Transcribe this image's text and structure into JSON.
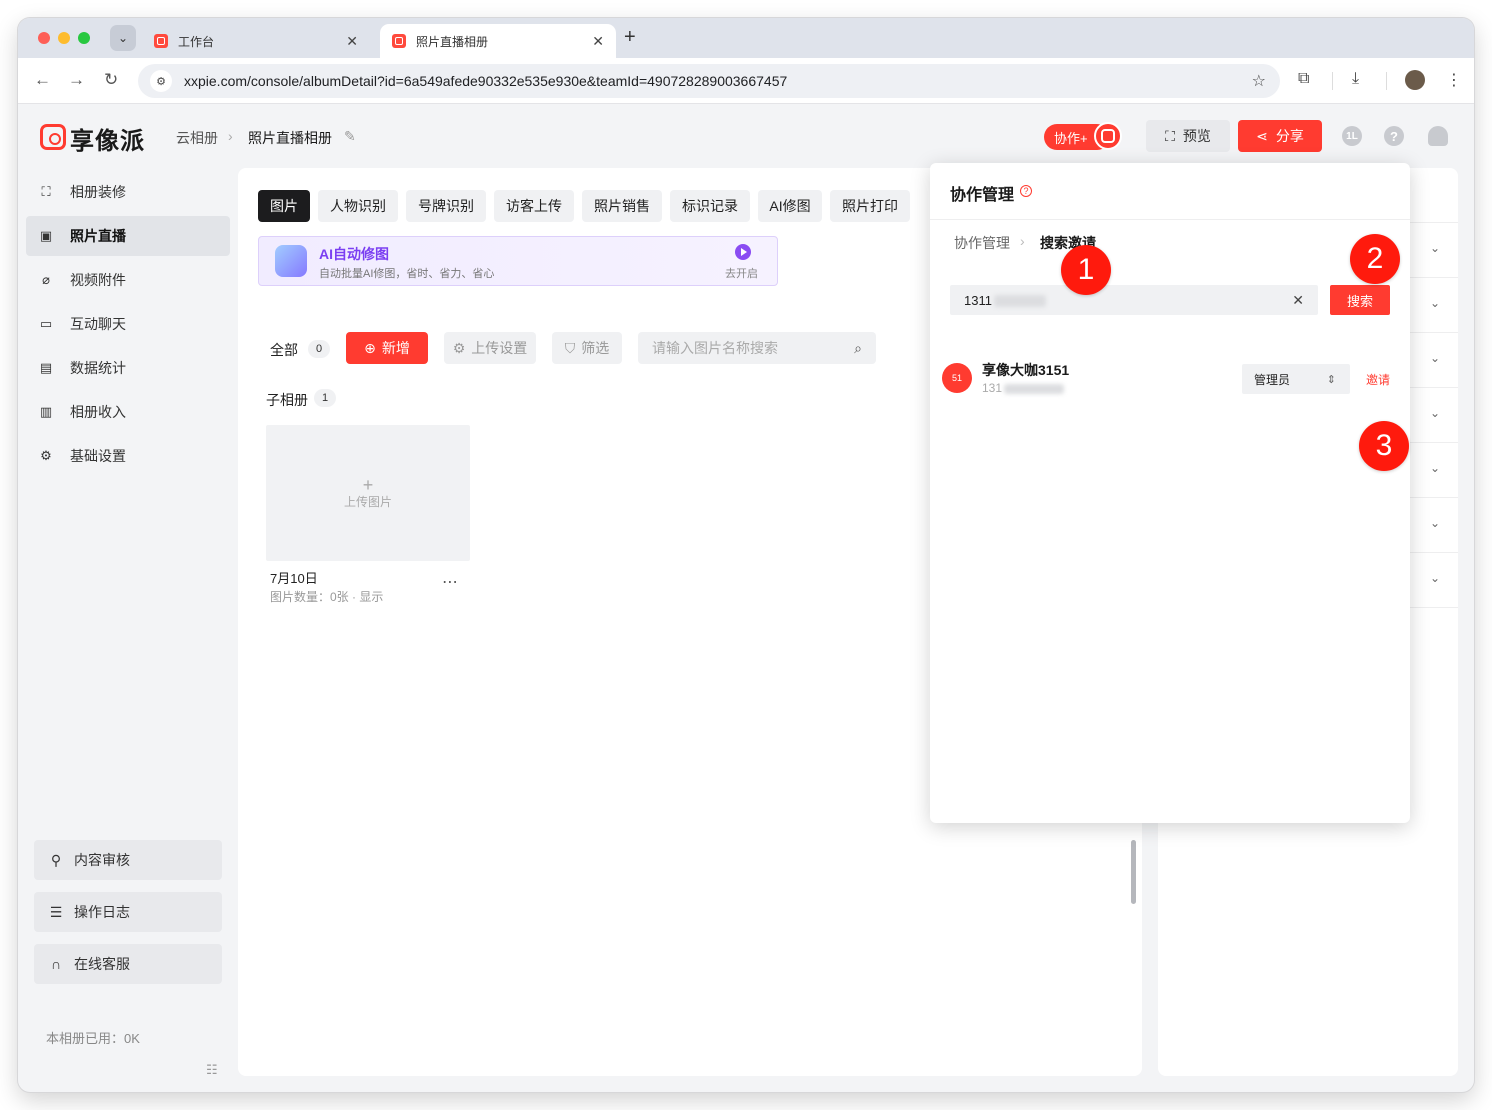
{
  "browser": {
    "tabs": [
      {
        "title": "工作台"
      },
      {
        "title": "照片直播相册"
      }
    ],
    "url": "xxpie.com/console/albumDetail?id=6a549afede90332e535e930e&teamId=490728289003667457",
    "icons": {
      "dropdown": "chevron-down-icon",
      "close": "close-icon",
      "new_tab": "plus-icon",
      "back": "arrow-left-icon",
      "forward": "arrow-right-icon",
      "reload": "reload-icon",
      "site_settings": "tune-icon",
      "bookmark": "star-icon",
      "extensions": "puzzle-icon",
      "download": "download-icon",
      "menu": "more-vertical-icon"
    }
  },
  "header": {
    "logo": "享像派",
    "breadcrumb": [
      "云相册",
      "照片直播相册"
    ],
    "collab_label": "协作+",
    "preview_label": "预览",
    "share_label": "分享",
    "user_initial": "1L"
  },
  "sidebar": {
    "items": [
      {
        "label": "相册装修",
        "icon": "frame-icon"
      },
      {
        "label": "照片直播",
        "icon": "image-icon",
        "active": true
      },
      {
        "label": "视频附件",
        "icon": "paperclip-icon"
      },
      {
        "label": "互动聊天",
        "icon": "chat-icon"
      },
      {
        "label": "数据统计",
        "icon": "chart-icon"
      },
      {
        "label": "相册收入",
        "icon": "wallet-icon"
      },
      {
        "label": "基础设置",
        "icon": "gear-icon"
      }
    ],
    "bottom": [
      {
        "label": "内容审核",
        "icon": "stamp-icon"
      },
      {
        "label": "操作日志",
        "icon": "document-icon"
      },
      {
        "label": "在线客服",
        "icon": "headset-icon"
      }
    ],
    "usage": "本相册已用：0K"
  },
  "main": {
    "tabs": [
      "图片",
      "人物识别",
      "号牌识别",
      "访客上传",
      "照片销售",
      "标识记录",
      "AI修图",
      "照片打印"
    ],
    "ai_banner": {
      "title": "AI自动修图",
      "subtitle": "自动批量AI修图，省时、省力、省心",
      "action": "去开启"
    },
    "filter_all": "全部",
    "all_count": "0",
    "add_label": "新增",
    "upload_settings_label": "上传设置",
    "filter_label": "筛选",
    "search_placeholder": "请输入图片名称搜索",
    "sub_album_label": "子相册",
    "sub_album_count": "1",
    "upload_label": "上传图片",
    "album_date": "7月10日",
    "album_meta": "图片数量：0张 · 显示"
  },
  "popover": {
    "title": "协作管理",
    "breadcrumb": [
      "协作管理",
      "搜索邀请"
    ],
    "search_value": "1311",
    "search_button": "搜索",
    "result": {
      "avatar": "51",
      "name": "享像大咖3151",
      "phone": "131",
      "role": "管理员",
      "invite": "邀请"
    }
  },
  "steps": [
    "1",
    "2",
    "3"
  ],
  "colors": {
    "brand_red": "#ff3b30",
    "ai_purple": "#7b3ff2",
    "active_tab": "#1c1c1e"
  }
}
